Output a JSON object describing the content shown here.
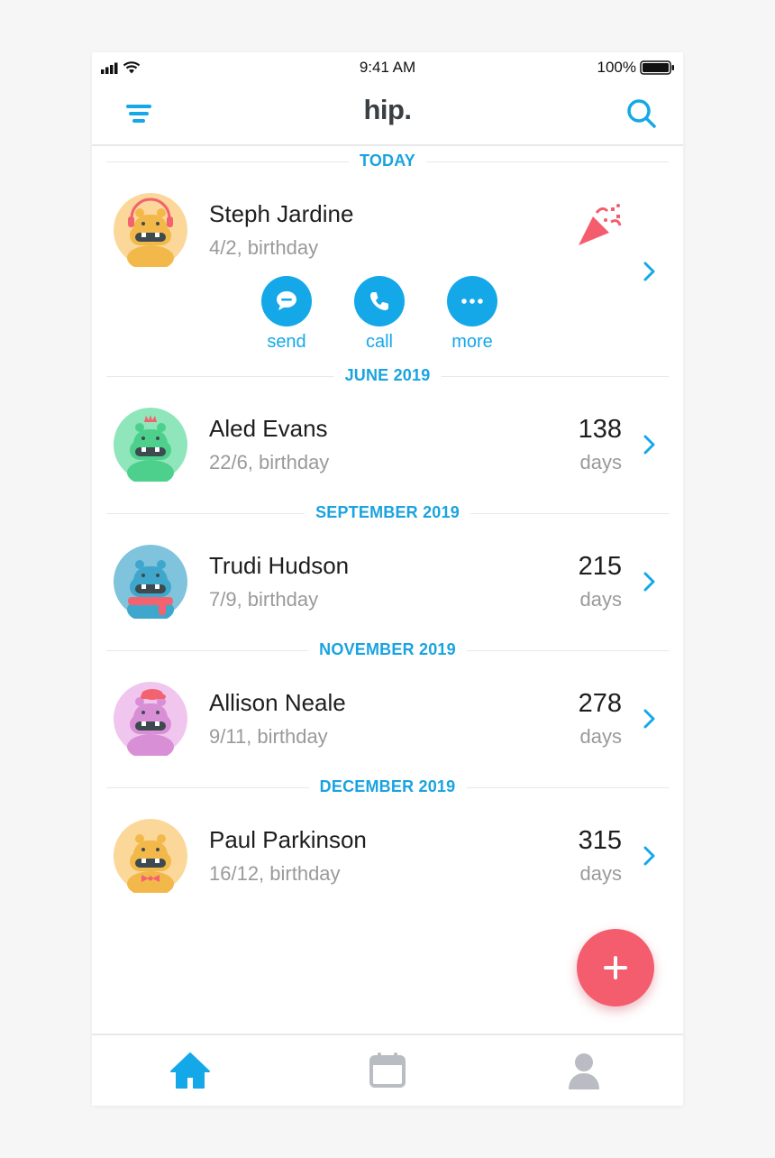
{
  "status_bar": {
    "time": "9:41 AM",
    "battery": "100%"
  },
  "nav": {
    "logo": "hip."
  },
  "today": {
    "header": "TODAY",
    "name": "Steph Jardine",
    "date": "4/2, birthday",
    "actions": [
      {
        "label": "send",
        "icon": "chat-bubble-icon"
      },
      {
        "label": "call",
        "icon": "phone-icon"
      },
      {
        "label": "more",
        "icon": "ellipsis-icon"
      }
    ]
  },
  "sections": [
    {
      "header": "JUNE 2019",
      "name": "Aled Evans",
      "date": "22/6, birthday",
      "days": "138",
      "days_label": "days",
      "avatar_color": "#7fe0b0"
    },
    {
      "header": "SEPTEMBER 2019",
      "name": "Trudi Hudson",
      "date": "7/9, birthday",
      "days": "215",
      "days_label": "days",
      "avatar_color": "#7fc4dc"
    },
    {
      "header": "NOVEMBER 2019",
      "name": "Allison Neale",
      "date": "9/11, birthday",
      "days": "278",
      "days_label": "days",
      "avatar_color": "#eebcea"
    },
    {
      "header": "DECEMBER 2019",
      "name": "Paul Parkinson",
      "date": "16/12, birthday",
      "days": "315",
      "days_label": "days",
      "avatar_color": "#fbd79a"
    }
  ],
  "colors": {
    "accent": "#14a8e9",
    "fab": "#f35d6e",
    "party": "#f35d6e"
  },
  "tabs": [
    "home-icon",
    "calendar-icon",
    "profile-icon"
  ]
}
